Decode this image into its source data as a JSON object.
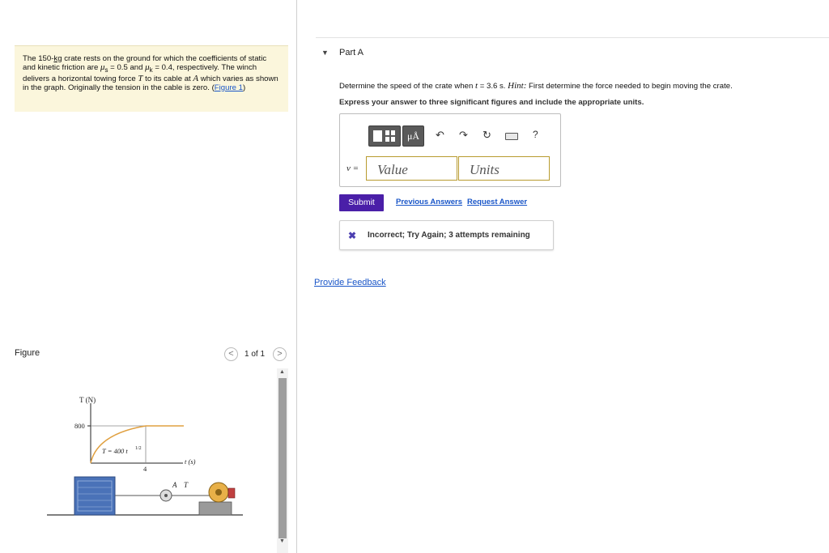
{
  "problem": {
    "t1": "The 150-",
    "mass_unit": "kg",
    "t2": " crate rests on the ground for which the coefficients of static and kinetic friction are ",
    "mu_s": "μ",
    "mu_s_sub": "s",
    "t3": " = 0.5 and ",
    "mu_k": "μ",
    "mu_k_sub": "k",
    "t4": " = 0.4, respectively. The winch delivers a horizontal towing force ",
    "force_var": "T",
    "t5": " to its cable at ",
    "point_var": "A",
    "t6": " which varies as shown in the graph. Originally the tension in the cable is zero. (",
    "figure_link": "Figure 1",
    "t7": ")"
  },
  "figure": {
    "label": "Figure",
    "pager_prev": "<",
    "pager_text": "1 of 1",
    "pager_next": ">",
    "scroll_up": "▲",
    "scroll_down": "▼",
    "graph": {
      "y_axis_label": "T (N)",
      "x_axis_label": "t (s)",
      "y_tick": "800",
      "x_tick": "4",
      "equation": "T = 400 t",
      "equation_exp": "1/2",
      "label_A": "A",
      "label_T": "T"
    }
  },
  "part": {
    "toggle": "▼",
    "title": "Part A",
    "question_1": "Determine the speed of the crate when ",
    "question_var": "t",
    "question_2": " = 3.6 s. ",
    "question_hint": "Hint:",
    "question_3": " First determine the force needed to begin moving the crate.",
    "instruction": "Express your answer to three significant figures and include the appropriate units."
  },
  "answer": {
    "units_tool": "μÅ",
    "undo": "↶",
    "redo": "↷",
    "reset": "↻",
    "help": "?",
    "variable_label": "v =",
    "value_placeholder": "Value",
    "units_placeholder": "Units"
  },
  "actions": {
    "submit": "Submit",
    "previous_answers": "Previous Answers",
    "request_answer": "Request Answer"
  },
  "feedback": {
    "icon": "✖",
    "message": "Incorrect; Try Again; 3 attempts remaining"
  },
  "footer": {
    "provide_feedback": "Provide Feedback"
  },
  "colors": {
    "problem_bg": "#fbf6dc",
    "submit_bg": "#4a1fa8",
    "link": "#1a56c8",
    "curve": "#e0a040",
    "input_border": "#b89b2f"
  }
}
